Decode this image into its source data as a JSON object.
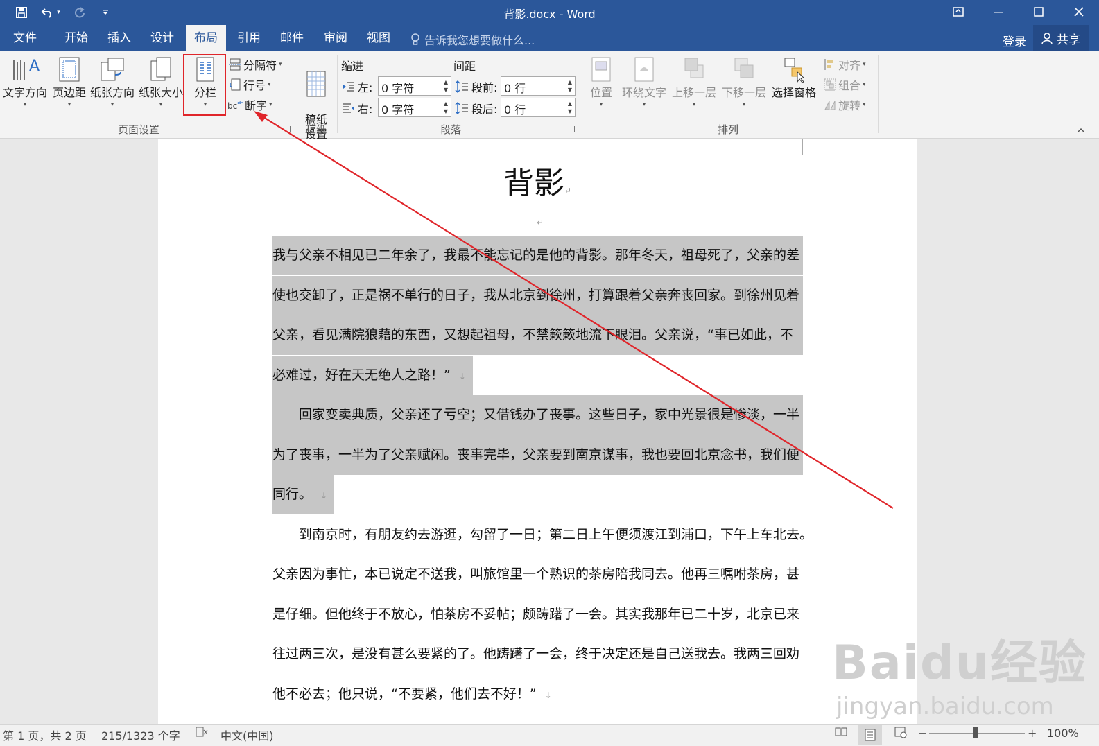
{
  "window": {
    "title": "背影.docx - Word",
    "qat": [
      "save-icon",
      "undo-icon",
      "redo-icon",
      "customize-icon"
    ],
    "controls": [
      "ribbon-display-icon",
      "minimize-icon",
      "maximize-icon",
      "close-icon"
    ]
  },
  "tabs": [
    {
      "label": "文件",
      "active": false
    },
    {
      "label": "开始",
      "active": false
    },
    {
      "label": "插入",
      "active": false
    },
    {
      "label": "设计",
      "active": false
    },
    {
      "label": "布局",
      "active": true
    },
    {
      "label": "引用",
      "active": false
    },
    {
      "label": "邮件",
      "active": false
    },
    {
      "label": "审阅",
      "active": false
    },
    {
      "label": "视图",
      "active": false
    }
  ],
  "tell_me": "告诉我您想要做什么...",
  "sign_in": "登录",
  "share": "共享",
  "ribbon": {
    "page_setup": {
      "label": "页面设置",
      "text_direction": "文字方向",
      "margins": "页边距",
      "orientation": "纸张方向",
      "size": "纸张大小",
      "columns": "分栏",
      "breaks": "分隔符",
      "line_numbers": "行号",
      "hyphenation": "断字"
    },
    "manuscript": {
      "label": "稿纸",
      "settings": "稿纸\n设置"
    },
    "paragraph": {
      "label": "段落",
      "indent_title": "缩进",
      "spacing_title": "间距",
      "left_label": "左:",
      "left_value": "0 字符",
      "right_label": "右:",
      "right_value": "0 字符",
      "before_label": "段前:",
      "before_value": "0 行",
      "after_label": "段后:",
      "after_value": "0 行"
    },
    "arrange": {
      "label": "排列",
      "position": "位置",
      "wrap_text": "环绕文字",
      "bring_forward": "上移一层",
      "send_backward": "下移一层",
      "selection_pane": "选择窗格",
      "align": "对齐",
      "group": "组合",
      "rotate": "旋转"
    }
  },
  "document": {
    "title": "背影",
    "lines": [
      {
        "text": "我与父亲不相见已二年余了，我最不能忘记的是他的背影。那年冬天，祖母死了，父亲的差",
        "selected": true
      },
      {
        "text": "使也交卸了，正是祸不单行的日子，我从北京到徐州，打算跟着父亲奔丧回家。到徐州见着",
        "selected": true
      },
      {
        "text": "父亲，看见满院狼藉的东西，又想起祖母，不禁簌簌地流下眼泪。父亲说，“事已如此，不",
        "selected": true
      },
      {
        "text": "必难过，好在天无绝人之路！”",
        "selected": true,
        "mark": true
      },
      {
        "text": "　　回家变卖典质，父亲还了亏空；又借钱办了丧事。这些日子，家中光景很是惨淡，一半",
        "selected": true
      },
      {
        "text": "为了丧事，一半为了父亲赋闲。丧事完毕，父亲要到南京谋事，我也要回北京念书，我们便",
        "selected": true
      },
      {
        "text": "同行。",
        "selected": true,
        "mark": true
      },
      {
        "text": "　　到南京时，有朋友约去游逛，勾留了一日；第二日上午便须渡江到浦口，下午上车北去。",
        "selected": false
      },
      {
        "text": "父亲因为事忙，本已说定不送我，叫旅馆里一个熟识的茶房陪我同去。他再三嘱咐茶房，甚",
        "selected": false
      },
      {
        "text": "是仔细。但他终于不放心，怕茶房不妥帖；颇踌躇了一会。其实我那年已二十岁，北京已来",
        "selected": false
      },
      {
        "text": "往过两三次，是没有甚么要紧的了。他踌躇了一会，终于决定还是自己送我去。我两三回劝",
        "selected": false
      },
      {
        "text": "他不必去；他只说，“不要紧，他们去不好！”",
        "selected": false,
        "mark": true
      }
    ]
  },
  "status": {
    "page": "第 1 页，共 2 页",
    "words": "215/1323 个字",
    "language": "中文(中国)",
    "zoom": "100%"
  },
  "watermark": {
    "main": "Baidu经验",
    "sub": "jingyan.baidu.com"
  },
  "colors": {
    "accent": "#2b579a",
    "highlight_box": "#e0252a",
    "selection": "#c6c6c6"
  }
}
